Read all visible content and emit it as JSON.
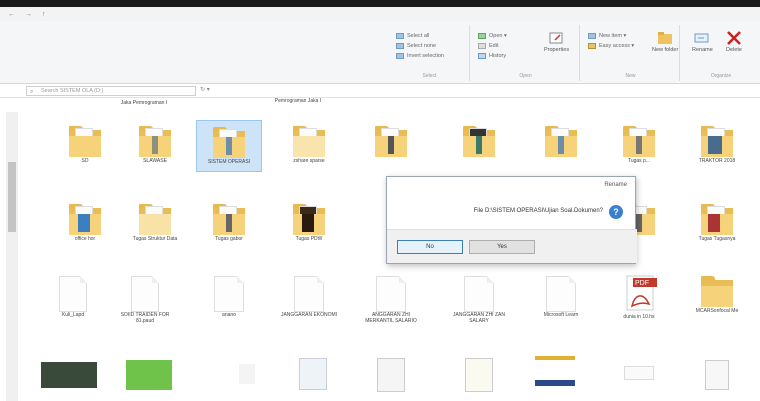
{
  "menu": [
    "←",
    "→",
    "↑"
  ],
  "ribbon": {
    "groups": [
      {
        "label": "Select",
        "items": [
          "Select all",
          "Select none",
          "Invert selection"
        ]
      },
      {
        "label": "Open",
        "items": [
          "Open ▾",
          "Edit",
          "History"
        ],
        "big": "Properties"
      },
      {
        "label": "New",
        "items": [
          "New item ▾",
          "Easy access ▾"
        ],
        "big": "New folder"
      },
      {
        "label": "Organize",
        "bigs": [
          "Rename",
          "Delete"
        ]
      }
    ]
  },
  "address": {
    "search_placeholder": "Search SISTEM OLA (D:)",
    "path": "↻  ▾"
  },
  "top_captions": [
    "Jaka Pemrograman I",
    "Pemrograman Jaka I"
  ],
  "row1": [
    "SD",
    "SLAWASE",
    "SISTEM OPERASI",
    "zshare sparse",
    "",
    "",
    "",
    "Tugas p...",
    "TRAKTOR 2018"
  ],
  "row2": [
    "office hor",
    "Tugas Struktur Data",
    "Tugas gabor",
    "Tugas PDW",
    "",
    "",
    "",
    "",
    "Tugas Tugasnya"
  ],
  "row3": [
    "Kuli_Lapd",
    "SOIID TRAIDEN FOR 81.paud",
    "anano",
    "JANGGARAN EKONOMI",
    "ANGGARAN ZHI MERKANTIL SALARIO",
    "JANGGARAN ZHI ZAN SALARY",
    "Microsoft Learn",
    "dunia in 10.hs",
    "MCARSonfocal Me"
  ],
  "dialog": {
    "title": "Rename",
    "message": "File D:\\SISTEM OPERASI\\Ujian Soal.Dokumen?",
    "yes": "Yes",
    "no": "No"
  },
  "colors": {
    "folder": "#e9bd55",
    "accent": "#2a6fcf",
    "close": "#cc2222"
  }
}
